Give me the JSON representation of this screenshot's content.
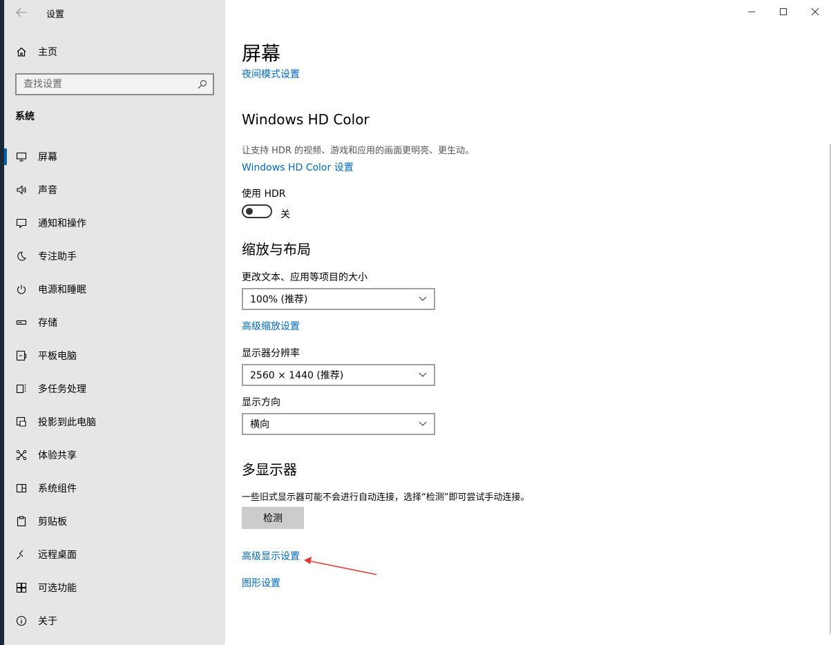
{
  "app": {
    "title": "设置",
    "back_icon": "back-arrow-icon"
  },
  "window_controls": {
    "minimize_icon": "minimize-icon",
    "maximize_icon": "maximize-icon",
    "close_icon": "close-icon"
  },
  "sidebar": {
    "home_label": "主页",
    "search_placeholder": "查找设置",
    "section_heading": "系统",
    "items": [
      {
        "label": "屏幕",
        "icon": "monitor-icon",
        "active": true
      },
      {
        "label": "声音",
        "icon": "speaker-icon"
      },
      {
        "label": "通知和操作",
        "icon": "notification-icon"
      },
      {
        "label": "专注助手",
        "icon": "moon-icon"
      },
      {
        "label": "电源和睡眠",
        "icon": "power-icon"
      },
      {
        "label": "存储",
        "icon": "storage-icon"
      },
      {
        "label": "平板电脑",
        "icon": "tablet-icon"
      },
      {
        "label": "多任务处理",
        "icon": "multitask-icon"
      },
      {
        "label": "投影到此电脑",
        "icon": "projection-icon"
      },
      {
        "label": "体验共享",
        "icon": "share-icon"
      },
      {
        "label": "系统组件",
        "icon": "components-icon"
      },
      {
        "label": "剪贴板",
        "icon": "clipboard-icon"
      },
      {
        "label": "远程桌面",
        "icon": "remote-desktop-icon"
      },
      {
        "label": "可选功能",
        "icon": "optional-features-icon"
      },
      {
        "label": "关于",
        "icon": "info-icon"
      }
    ]
  },
  "main": {
    "page_title": "屏幕",
    "night_light_link": "夜间模式设置",
    "hd_color": {
      "heading": "Windows HD Color",
      "description": "让支持 HDR 的视频、游戏和应用的画面更明亮、更生动。",
      "settings_link": "Windows HD Color 设置",
      "hdr_label": "使用 HDR",
      "hdr_state": "关",
      "hdr_on": false
    },
    "scale_layout": {
      "heading": "缩放与布局",
      "text_size_label": "更改文本、应用等项目的大小",
      "text_size_value": "100% (推荐)",
      "advanced_scaling_link": "高级缩放设置",
      "resolution_label": "显示器分辨率",
      "resolution_value": "2560 × 1440 (推荐)",
      "orientation_label": "显示方向",
      "orientation_value": "横向"
    },
    "multi_display": {
      "heading": "多显示器",
      "description": "一些旧式显示器可能不会进行自动连接，选择“检测”即可尝试手动连接。",
      "detect_button": "检测",
      "advanced_display_link": "高级显示设置",
      "graphics_link": "图形设置"
    }
  },
  "colors": {
    "accent": "#0063b1",
    "link": "#0067c0",
    "sidebar_bg": "#e6e6e6",
    "annotation_arrow": "#e53935"
  }
}
